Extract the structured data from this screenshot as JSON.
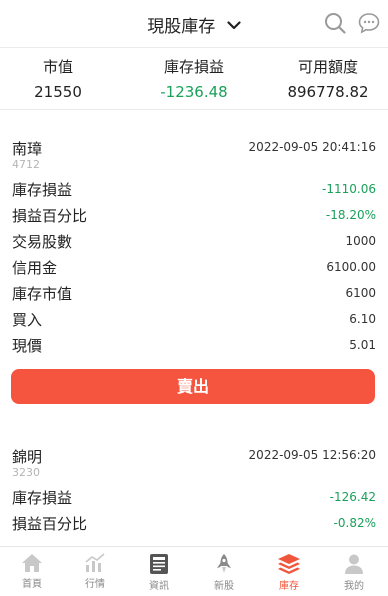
{
  "header": {
    "title": "現股庫存"
  },
  "summary": [
    {
      "label": "市值",
      "value": "21550"
    },
    {
      "label": "庫存損益",
      "value": "-1236.48"
    },
    {
      "label": "可用額度",
      "value": "896778.82"
    }
  ],
  "holdings": [
    {
      "name": "南璋",
      "code": "4712",
      "time": "2022-09-05 20:41:16",
      "rows": [
        {
          "label": "庫存損益",
          "value": "-1110.06"
        },
        {
          "label": "損益百分比",
          "value": "-18.20%"
        },
        {
          "label": "交易股數",
          "value": "1000"
        },
        {
          "label": "信用金",
          "value": "6100.00"
        },
        {
          "label": "庫存市值",
          "value": "6100"
        },
        {
          "label": "買入",
          "value": "6.10"
        },
        {
          "label": "現價",
          "value": "5.01"
        }
      ],
      "sell_label": "賣出"
    },
    {
      "name": "錦明",
      "code": "3230",
      "time": "2022-09-05 12:56:20",
      "rows": [
        {
          "label": "庫存損益",
          "value": "-126.42"
        },
        {
          "label": "損益百分比",
          "value": "-0.82%"
        }
      ]
    }
  ],
  "tabs": [
    {
      "label": "首頁",
      "icon": "home-icon"
    },
    {
      "label": "行情",
      "icon": "chart-icon"
    },
    {
      "label": "資訊",
      "icon": "news-icon"
    },
    {
      "label": "新股",
      "icon": "rocket-icon"
    },
    {
      "label": "庫存",
      "icon": "layers-icon",
      "active": true
    },
    {
      "label": "我的",
      "icon": "user-icon"
    }
  ],
  "colors": {
    "accent": "#f5553f",
    "loss": "#1aa05a",
    "active_tab": "#f0563b",
    "inactive_tab": "#c8c8c8"
  }
}
